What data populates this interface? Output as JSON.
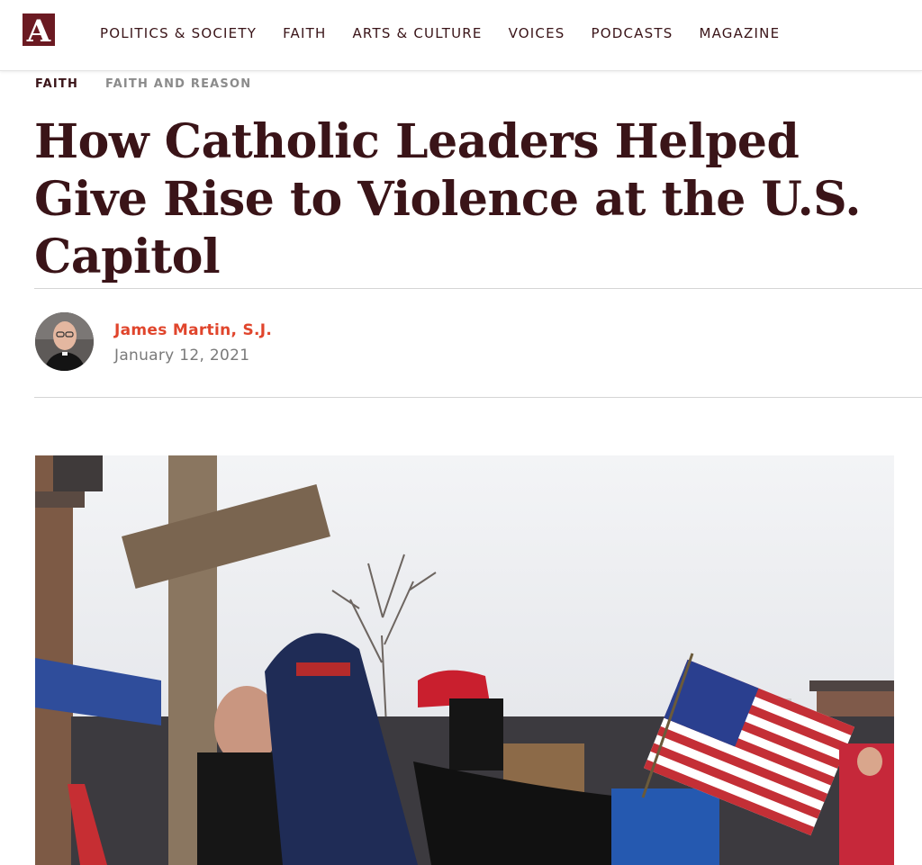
{
  "header": {
    "logo_letter": "A",
    "nav": [
      {
        "label": "POLITICS & SOCIETY"
      },
      {
        "label": "FAITH"
      },
      {
        "label": "ARTS & CULTURE"
      },
      {
        "label": "VOICES"
      },
      {
        "label": "PODCASTS"
      },
      {
        "label": "MAGAZINE"
      }
    ]
  },
  "breadcrumb": {
    "primary": "FAITH",
    "secondary": "FAITH AND REASON"
  },
  "article": {
    "title": "How Catholic Leaders Helped Give Rise to Violence at the U.S. Capitol",
    "author": "James Martin, S.J.",
    "date": "January 12, 2021"
  },
  "colors": {
    "brand_maroon": "#3a1418",
    "author_red": "#e0452c",
    "muted_gray": "#8b8b8b"
  }
}
